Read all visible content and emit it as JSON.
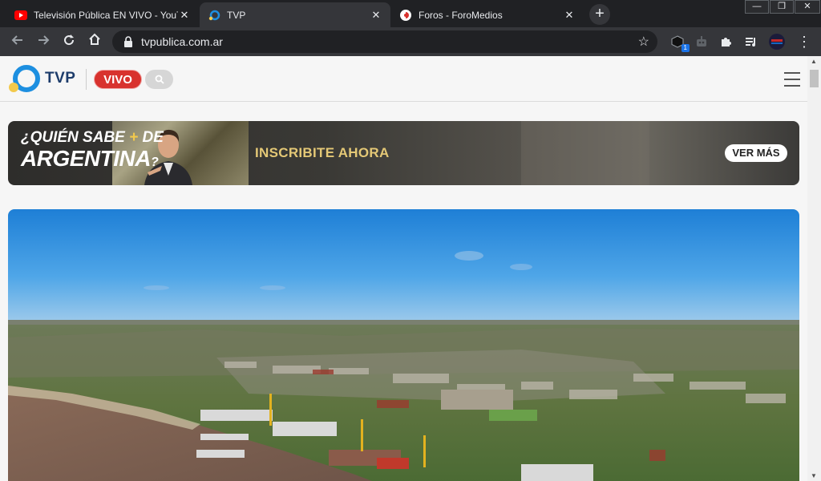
{
  "browser": {
    "tabs": [
      {
        "title": "Televisión Pública EN VIVO - YouTube",
        "favicon": "youtube-icon",
        "active": false
      },
      {
        "title": "TVP",
        "favicon": "tvp-icon",
        "active": true
      },
      {
        "title": "Foros - ForoMedios",
        "favicon": "foromedios-icon",
        "active": false
      }
    ],
    "new_tab": "+",
    "window_controls": {
      "minimize": "—",
      "restore": "❐",
      "close": "✕"
    },
    "url": "tvpublica.com.ar",
    "extension_badge": "1"
  },
  "site": {
    "logo_text": "TVP",
    "vivo_label": "VIVO",
    "banner": {
      "title_line1": "¿QUIÉN SABE",
      "title_plus": "+",
      "title_de": "DE",
      "title_line2": "ARGENTINA",
      "title_q": "?",
      "cta": "INSCRIBITE AHORA",
      "button": "VER MÁS"
    }
  },
  "colors": {
    "vivo_red": "#d8322e",
    "brand_blue": "#1d8fe0",
    "brand_yellow": "#f2c94c",
    "cta_gold": "#e4c876"
  }
}
